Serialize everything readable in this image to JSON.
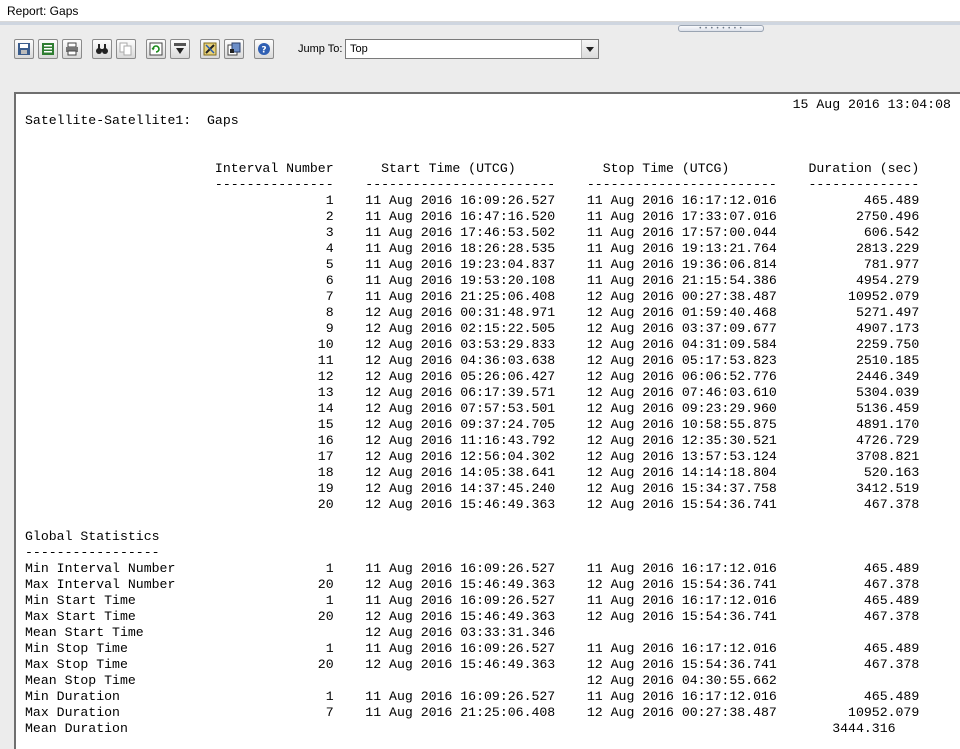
{
  "window": {
    "title": "Report: Gaps"
  },
  "toolbar": {
    "buttons": [
      {
        "name": "save-icon"
      },
      {
        "name": "export-icon"
      },
      {
        "name": "print-icon"
      },
      {
        "name": "find-icon"
      },
      {
        "name": "copy-icon"
      },
      {
        "name": "refresh-icon"
      },
      {
        "name": "expand-icon"
      },
      {
        "name": "edit-icon"
      },
      {
        "name": "properties-icon"
      },
      {
        "name": "help-icon"
      }
    ],
    "jump_to_label": "Jump To:",
    "jump_to_value": "Top"
  },
  "report": {
    "lines": [
      "                                                                                                 15 Aug 2016 13:04:08",
      "Satellite-Satellite1:  Gaps",
      "",
      "",
      "                        Interval Number      Start Time (UTCG)           Stop Time (UTCG)          Duration (sec)",
      "                        ---------------    ------------------------    ------------------------    --------------",
      "                                      1    11 Aug 2016 16:09:26.527    11 Aug 2016 16:17:12.016           465.489",
      "                                      2    11 Aug 2016 16:47:16.520    11 Aug 2016 17:33:07.016          2750.496",
      "                                      3    11 Aug 2016 17:46:53.502    11 Aug 2016 17:57:00.044           606.542",
      "                                      4    11 Aug 2016 18:26:28.535    11 Aug 2016 19:13:21.764          2813.229",
      "                                      5    11 Aug 2016 19:23:04.837    11 Aug 2016 19:36:06.814           781.977",
      "                                      6    11 Aug 2016 19:53:20.108    11 Aug 2016 21:15:54.386          4954.279",
      "                                      7    11 Aug 2016 21:25:06.408    12 Aug 2016 00:27:38.487         10952.079",
      "                                      8    12 Aug 2016 00:31:48.971    12 Aug 2016 01:59:40.468          5271.497",
      "                                      9    12 Aug 2016 02:15:22.505    12 Aug 2016 03:37:09.677          4907.173",
      "                                     10    12 Aug 2016 03:53:29.833    12 Aug 2016 04:31:09.584          2259.750",
      "                                     11    12 Aug 2016 04:36:03.638    12 Aug 2016 05:17:53.823          2510.185",
      "                                     12    12 Aug 2016 05:26:06.427    12 Aug 2016 06:06:52.776          2446.349",
      "                                     13    12 Aug 2016 06:17:39.571    12 Aug 2016 07:46:03.610          5304.039",
      "                                     14    12 Aug 2016 07:57:53.501    12 Aug 2016 09:23:29.960          5136.459",
      "                                     15    12 Aug 2016 09:37:24.705    12 Aug 2016 10:58:55.875          4891.170",
      "                                     16    12 Aug 2016 11:16:43.792    12 Aug 2016 12:35:30.521          4726.729",
      "                                     17    12 Aug 2016 12:56:04.302    12 Aug 2016 13:57:53.124          3708.821",
      "                                     18    12 Aug 2016 14:05:38.641    12 Aug 2016 14:14:18.804           520.163",
      "                                     19    12 Aug 2016 14:37:45.240    12 Aug 2016 15:34:37.758          3412.519",
      "                                     20    12 Aug 2016 15:46:49.363    12 Aug 2016 15:54:36.741           467.378",
      "",
      "Global Statistics",
      "-----------------",
      "Min Interval Number                   1    11 Aug 2016 16:09:26.527    11 Aug 2016 16:17:12.016           465.489",
      "Max Interval Number                  20    12 Aug 2016 15:46:49.363    12 Aug 2016 15:54:36.741           467.378",
      "Min Start Time                        1    11 Aug 2016 16:09:26.527    11 Aug 2016 16:17:12.016           465.489",
      "Max Start Time                       20    12 Aug 2016 15:46:49.363    12 Aug 2016 15:54:36.741           467.378",
      "Mean Start Time                            12 Aug 2016 03:33:31.346",
      "Min Stop Time                         1    11 Aug 2016 16:09:26.527    11 Aug 2016 16:17:12.016           465.489",
      "Max Stop Time                        20    12 Aug 2016 15:46:49.363    12 Aug 2016 15:54:36.741           467.378",
      "Mean Stop Time                                                         12 Aug 2016 04:30:55.662",
      "Min Duration                          1    11 Aug 2016 16:09:26.527    11 Aug 2016 16:17:12.016           465.489",
      "Max Duration                          7    11 Aug 2016 21:25:06.408    12 Aug 2016 00:27:38.487         10952.079",
      "Mean Duration                                                                                         3444.316"
    ]
  }
}
